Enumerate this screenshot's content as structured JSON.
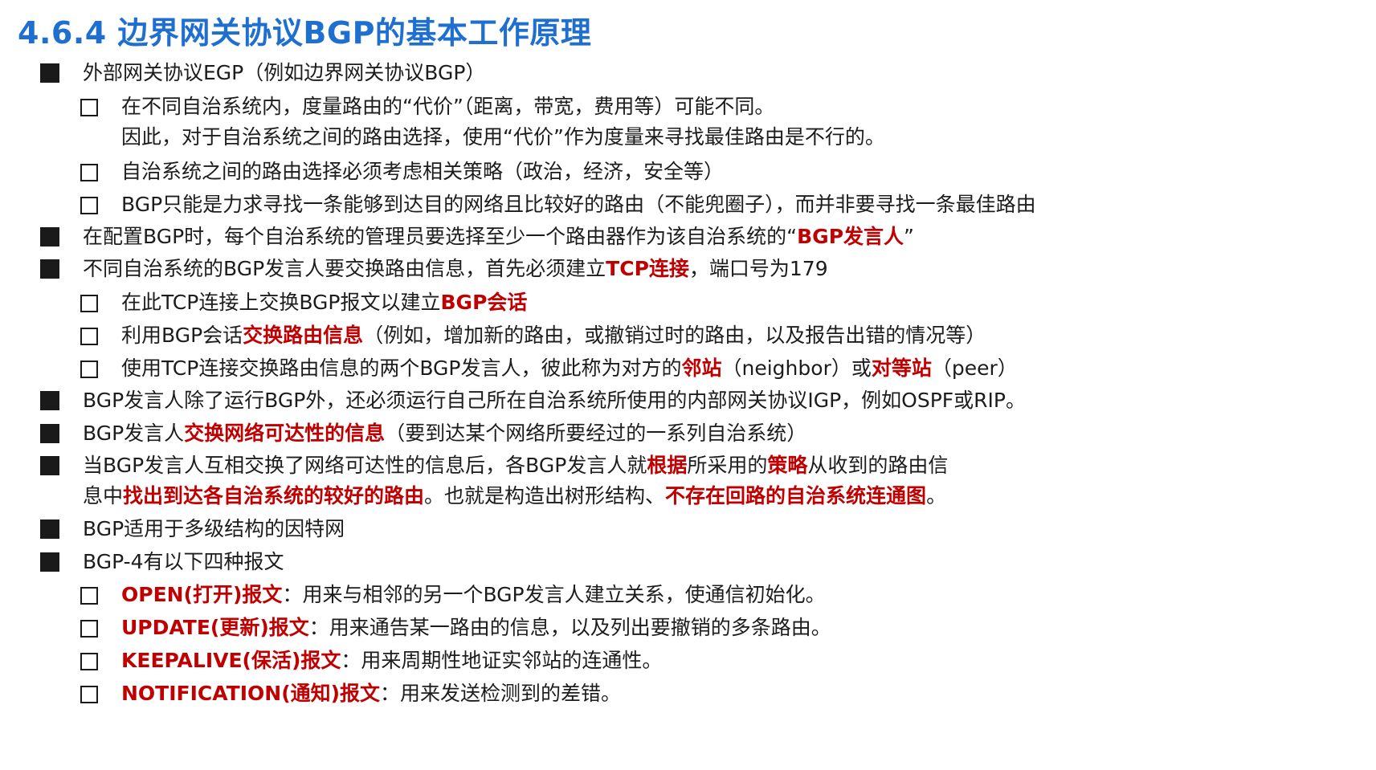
{
  "title": "4.6.4 边界网关协议BGP的基本工作原理",
  "items": [
    {
      "level": 1,
      "parts": [
        {
          "t": "外部网关协议EGP（例如边界网关协议BGP）"
        }
      ]
    },
    {
      "level": 2,
      "parts": [
        {
          "t": "在不同自治系统内，度量路由的“代价”（距离，带宽，费用等）可能不同。"
        }
      ],
      "cont": [
        {
          "t": "因此，对于自治系统之间的路由选择，使用“代价”作为度量来寻找最佳路由是不行的。"
        }
      ]
    },
    {
      "level": 2,
      "parts": [
        {
          "t": "自治系统之间的路由选择必须考虑相关策略（政治，经济，安全等）"
        }
      ]
    },
    {
      "level": 2,
      "parts": [
        {
          "t": "BGP只能是力求寻找一条能够到达目的网络且比较好的路由（不能兜圈子），而并非要寻找一条最佳路由"
        }
      ]
    },
    {
      "level": 1,
      "parts": [
        {
          "t": "在配置BGP时，每个自治系统的管理员要选择至少一个路由器作为该自治系统的“"
        },
        {
          "t": "BGP发言人",
          "red": true
        },
        {
          "t": "”"
        }
      ]
    },
    {
      "level": 1,
      "parts": [
        {
          "t": "不同自治系统的BGP发言人要交换路由信息，首先必须建立"
        },
        {
          "t": "TCP连接",
          "red": true
        },
        {
          "t": "，端口号为179"
        }
      ]
    },
    {
      "level": 2,
      "parts": [
        {
          "t": "在此TCP连接上交换BGP报文以建立"
        },
        {
          "t": "BGP会话",
          "red": true
        }
      ]
    },
    {
      "level": 2,
      "parts": [
        {
          "t": "利用BGP会话"
        },
        {
          "t": "交换路由信息",
          "red": true
        },
        {
          "t": "（例如，增加新的路由，或撤销过时的路由，以及报告出错的情况等）"
        }
      ]
    },
    {
      "level": 2,
      "parts": [
        {
          "t": "使用TCP连接交换路由信息的两个BGP发言人，彼此称为对方的"
        },
        {
          "t": "邻站",
          "red": true
        },
        {
          "t": "（neighbor）或"
        },
        {
          "t": "对等站",
          "red": true
        },
        {
          "t": "（peer）"
        }
      ]
    },
    {
      "level": 1,
      "parts": [
        {
          "t": "BGP发言人除了运行BGP外，还必须运行自己所在自治系统所使用的内部网关协议IGP，例如OSPF或RIP。"
        }
      ]
    },
    {
      "level": 1,
      "parts": [
        {
          "t": "BGP发言人"
        },
        {
          "t": "交换网络可达性的信息",
          "red": true
        },
        {
          "t": "（要到达某个网络所要经过的一系列自治系统）"
        }
      ]
    },
    {
      "level": 1,
      "parts": [
        {
          "t": "当BGP发言人互相交换了网络可达性的信息后，各BGP发言人就"
        },
        {
          "t": "根据",
          "red": true
        },
        {
          "t": "所采用的"
        },
        {
          "t": "策略",
          "red": true
        },
        {
          "t": "从收到的路由信"
        }
      ],
      "cont": [
        {
          "t": "息中"
        },
        {
          "t": "找出到达各自治系统的较好的路由",
          "red": true
        },
        {
          "t": "。也就是构造出树形结构、"
        },
        {
          "t": "不存在回路的自治系统连通图",
          "red": true
        },
        {
          "t": "。"
        }
      ]
    },
    {
      "level": 1,
      "parts": [
        {
          "t": "BGP适用于多级结构的因特网"
        }
      ]
    },
    {
      "level": 1,
      "parts": [
        {
          "t": "BGP-4有以下四种报文"
        }
      ]
    },
    {
      "level": 2,
      "parts": [
        {
          "t": "OPEN(打开)报文",
          "red": true
        },
        {
          "t": "：用来与相邻的另一个BGP发言人建立关系，使通信初始化。"
        }
      ]
    },
    {
      "level": 2,
      "parts": [
        {
          "t": "UPDATE(更新)报文",
          "red": true
        },
        {
          "t": "：用来通告某一路由的信息，以及列出要撤销的多条路由。"
        }
      ]
    },
    {
      "level": 2,
      "parts": [
        {
          "t": "KEEPALIVE(保活)报文",
          "red": true
        },
        {
          "t": "：用来周期性地证实邻站的连通性。"
        }
      ]
    },
    {
      "level": 2,
      "parts": [
        {
          "t": "NOTIFICATION(通知)报文",
          "red": true
        },
        {
          "t": "：用来发送检测到的差错。"
        }
      ]
    }
  ]
}
